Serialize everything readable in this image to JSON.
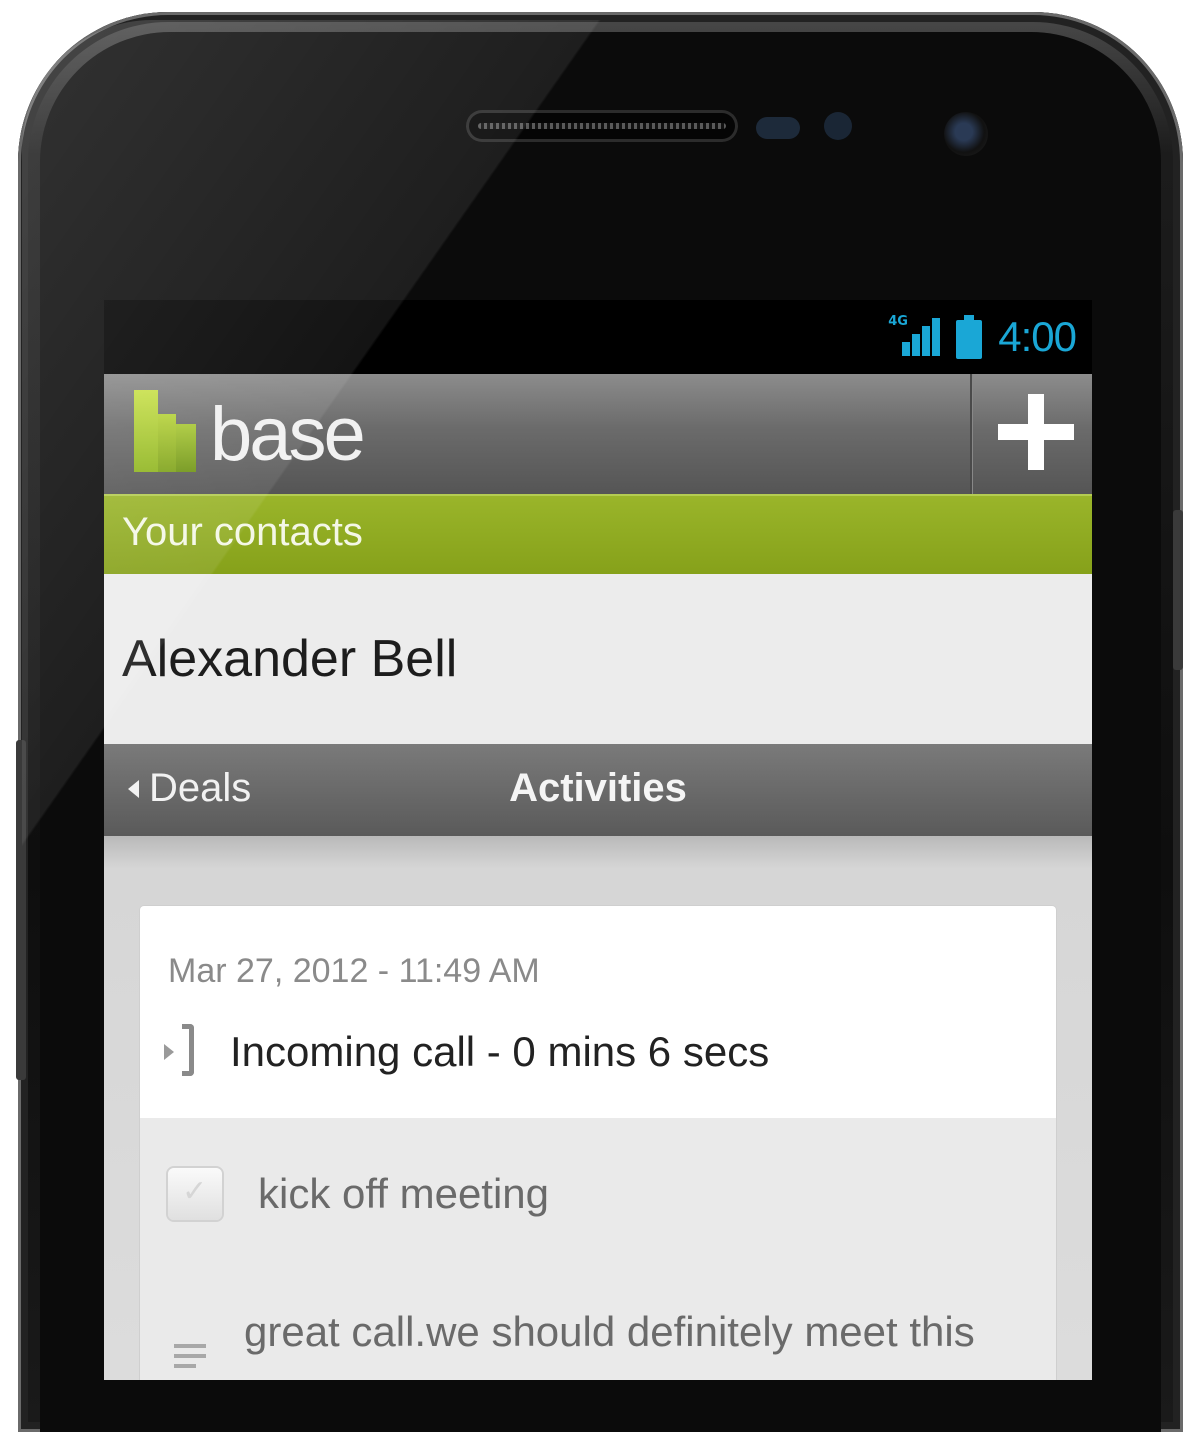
{
  "status_bar": {
    "network_label": "4G",
    "signal_icon": "signal-icon",
    "battery_icon": "battery-icon",
    "time": "4:00",
    "accent_color": "#1aa7d6"
  },
  "app_bar": {
    "logo_icon": "base-logo-icon",
    "brand": "base",
    "add_icon": "plus-icon"
  },
  "section": {
    "title": "Your contacts",
    "color": "#8fab20"
  },
  "contact": {
    "name": "Alexander Bell"
  },
  "tabs": {
    "previous": "Deals",
    "current": "Activities"
  },
  "activity": {
    "date": "Mar 27, 2012 - 11:49 AM",
    "call_icon": "incoming-call-icon",
    "call_text": "Incoming call - 0 mins 6 secs",
    "task_icon": "checkbox-icon",
    "task_text": "kick off meeting",
    "note_icon": "note-icon",
    "note_text": "great call.we should definitely meet this"
  }
}
